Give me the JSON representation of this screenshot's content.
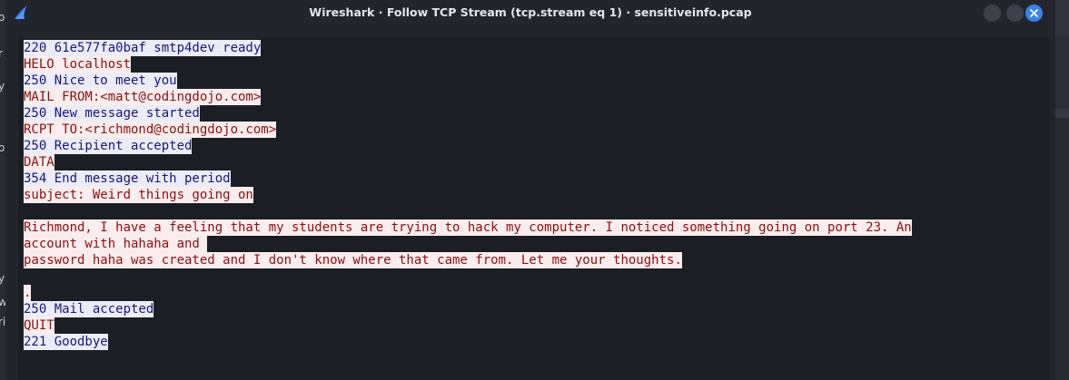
{
  "window": {
    "title": "Wireshark · Follow TCP Stream (tcp.stream eq 1) · sensitiveinfo.pcap",
    "app_icon": "wireshark-fin-icon",
    "buttons": {
      "minimize": "minimize-button",
      "maximize": "maximize-button",
      "close": "close-icon"
    },
    "accent_color": "#3b82f0"
  },
  "background_fragments": [
    "o",
    "r",
    "y",
    "o",
    "y",
    "w",
    "ri"
  ],
  "stream": {
    "client_color": "#8b0f0f",
    "client_bg": "#fbeded",
    "server_color": "#16177a",
    "server_bg": "#ececf8",
    "lines": [
      {
        "dir": "server",
        "text": "220 61e577fa0baf smtp4dev ready"
      },
      {
        "dir": "client",
        "text": "HELO localhost"
      },
      {
        "dir": "server",
        "text": "250 Nice to meet you"
      },
      {
        "dir": "client",
        "text": "MAIL FROM:<matt@codingdojo.com>"
      },
      {
        "dir": "server",
        "text": "250 New message started"
      },
      {
        "dir": "client",
        "text": "RCPT TO:<richmond@codingdojo.com>"
      },
      {
        "dir": "server",
        "text": "250 Recipient accepted"
      },
      {
        "dir": "client",
        "text": "DATA"
      },
      {
        "dir": "server",
        "text": "354 End message with period"
      },
      {
        "dir": "client",
        "text": "subject: Weird things going on"
      },
      {
        "dir": "blank",
        "text": ""
      },
      {
        "dir": "client",
        "text": "Richmond, I have a feeling that my students are trying to hack my computer. I noticed something going on port 23. An"
      },
      {
        "dir": "client",
        "text": "account with hahaha and "
      },
      {
        "dir": "client",
        "text": "password haha was created and I don't know where that came from. Let me your thoughts."
      },
      {
        "dir": "blank",
        "text": ""
      },
      {
        "dir": "client",
        "text": "."
      },
      {
        "dir": "server",
        "text": "250 Mail accepted"
      },
      {
        "dir": "client",
        "text": "QUIT"
      },
      {
        "dir": "server",
        "text": "221 Goodbye"
      }
    ]
  }
}
